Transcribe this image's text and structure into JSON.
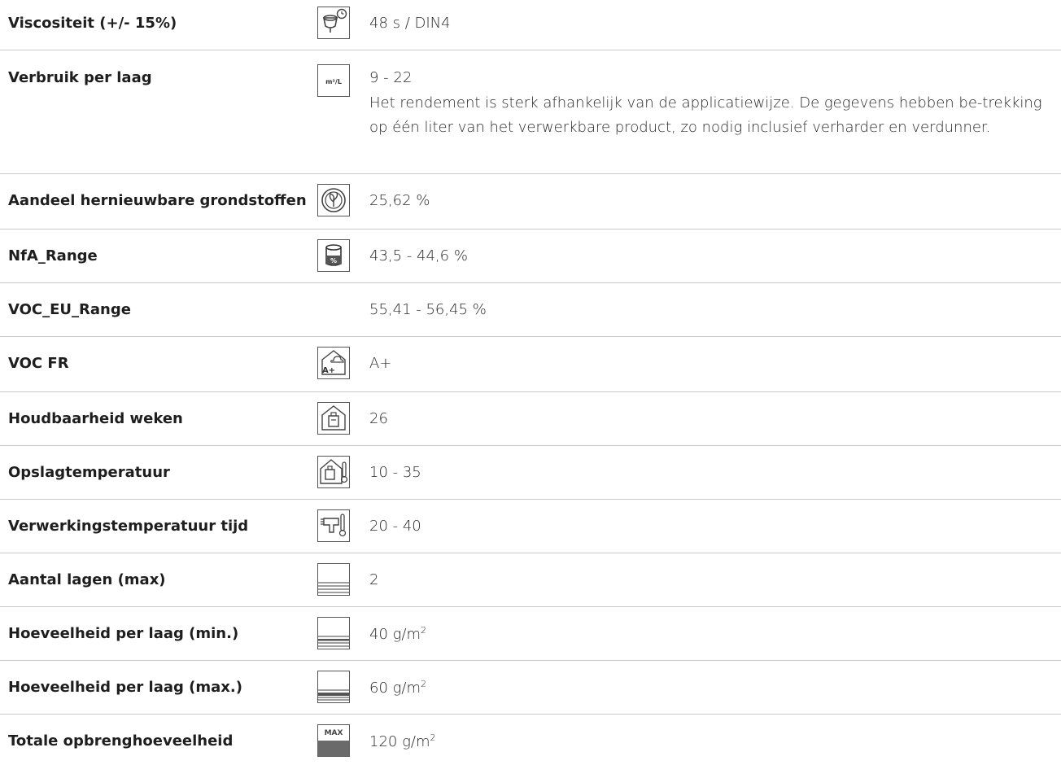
{
  "rows": [
    {
      "label": "Viscositeit (+/- 15%)",
      "icon": "viscosity-cup-timer-icon",
      "value": "48 s / DIN4"
    },
    {
      "label": "Verbruik per laag",
      "icon": "m2-per-liter-icon",
      "icon_text": "m²/L",
      "value": "9 - 22",
      "note": "Het rendement is sterk afhankelijk van de applicatiewijze. De gegevens hebben be-trekking op één liter van het verwerkbare product, zo nodig inclusief verharder en verdunner."
    },
    {
      "label": "Aandeel hernieuwbare grondstoffen",
      "icon": "renewable-leaf-icon",
      "value": "25,62 %"
    },
    {
      "label": "NfA_Range",
      "icon": "solids-can-icon",
      "value": "43,5 - 44,6 %"
    },
    {
      "label": "VOC_EU_Range",
      "icon": "",
      "value": "55,41 - 56,45 %"
    },
    {
      "label": "VOC FR",
      "icon": "voc-fr-house-icon",
      "icon_text": "A+",
      "value": "A+"
    },
    {
      "label": "Houdbaarheid weken",
      "icon": "shelf-life-house-icon",
      "value": "26"
    },
    {
      "label": "Opslagtemperatuur",
      "icon": "storage-temperature-icon",
      "value": "10 - 35"
    },
    {
      "label": "Verwerkingstemperatuur tijd",
      "icon": "spray-gun-thermometer-icon",
      "value": "20 - 40"
    },
    {
      "label": "Aantal lagen (max)",
      "icon": "layers-count-icon",
      "value": "2"
    },
    {
      "label": "Hoeveelheid per laag (min.)",
      "icon": "layer-min-icon",
      "value": "40 g/m",
      "value_sup": "2"
    },
    {
      "label": "Hoeveelheid per laag (max.)",
      "icon": "layer-max-icon",
      "value": "60 g/m",
      "value_sup": "2"
    },
    {
      "label": "Totale opbrenghoeveelheid",
      "icon": "total-max-icon",
      "icon_text": "MAX",
      "value": "120 g/m",
      "value_sup": "2"
    }
  ]
}
